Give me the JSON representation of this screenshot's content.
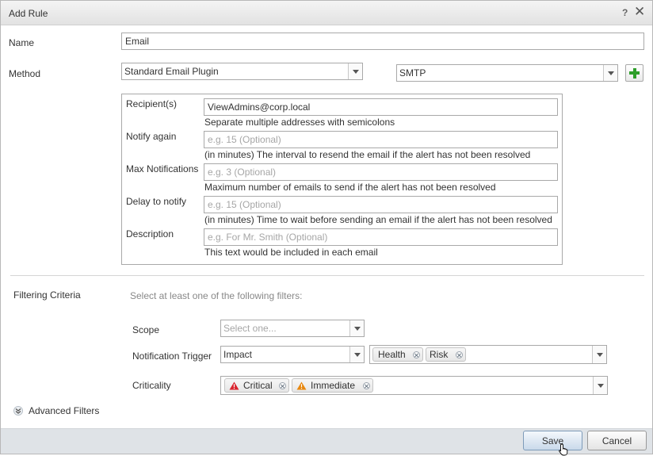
{
  "window": {
    "title": "Add Rule",
    "help_label": "?",
    "close_label": "✕"
  },
  "form": {
    "name": {
      "label": "Name",
      "value": "Email"
    },
    "method": {
      "label": "Method",
      "plugin": "Standard Email Plugin",
      "instance": "SMTP",
      "add_icon": "plus-icon"
    },
    "plugin_settings": {
      "recipients": {
        "label": "Recipient(s)",
        "value": "ViewAdmins@corp.local",
        "placeholder": "",
        "hint": "Separate multiple addresses with semicolons"
      },
      "notify_again": {
        "label": "Notify again",
        "value": "",
        "placeholder": "e.g. 15 (Optional)",
        "hint": "(in minutes) The interval to resend the email if the alert has not been resolved"
      },
      "max_notifications": {
        "label": "Max Notifications",
        "value": "",
        "placeholder": "e.g. 3 (Optional)",
        "hint": "Maximum number of emails to send if the alert has not been resolved"
      },
      "delay_to_notify": {
        "label": "Delay to notify",
        "value": "",
        "placeholder": "e.g. 15 (Optional)",
        "hint": "(in minutes) Time to wait before sending an email if the alert has not been resolved"
      },
      "description": {
        "label": "Description",
        "value": "",
        "placeholder": "e.g. For Mr. Smith (Optional)",
        "hint": "This text would be included in each email"
      }
    }
  },
  "filtering": {
    "label": "Filtering Criteria",
    "hint": "Select at least one of the following filters:",
    "scope": {
      "label": "Scope",
      "placeholder": "Select one..."
    },
    "notification_trigger": {
      "label": "Notification Trigger",
      "value": "Impact",
      "tags": [
        "Health",
        "Risk"
      ]
    },
    "criticality": {
      "label": "Criticality",
      "tags": [
        {
          "label": "Critical",
          "icon": "warning-icon",
          "color": "#d9232d"
        },
        {
          "label": "Immediate",
          "icon": "warning-icon",
          "color": "#e8870e"
        }
      ]
    },
    "advanced": {
      "label": "Advanced Filters",
      "icon": "double-chevron-down-icon"
    }
  },
  "footer": {
    "save_label": "Save",
    "cancel_label": "Cancel"
  },
  "colors": {
    "accent_green": "#2e9e2a",
    "footer_bg": "#dfe3e7",
    "critical": "#d9232d",
    "immediate": "#e8870e"
  }
}
